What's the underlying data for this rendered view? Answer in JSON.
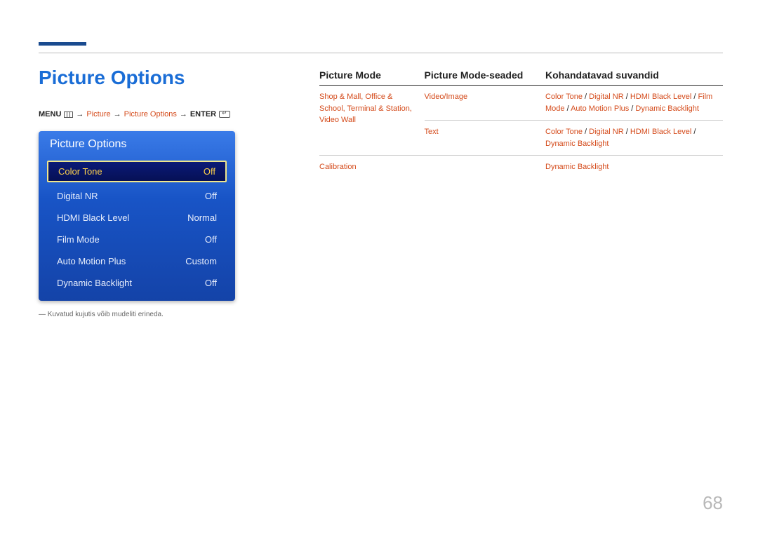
{
  "title": "Picture Options",
  "breadcrumb": {
    "menu": "MENU",
    "seg1": "Picture",
    "seg2": "Picture Options",
    "enter": "ENTER"
  },
  "osd": {
    "title": "Picture Options",
    "rows": [
      {
        "label": "Color Tone",
        "value": "Off"
      },
      {
        "label": "Digital NR",
        "value": "Off"
      },
      {
        "label": "HDMI Black Level",
        "value": "Normal"
      },
      {
        "label": "Film Mode",
        "value": "Off"
      },
      {
        "label": "Auto Motion Plus",
        "value": "Custom"
      },
      {
        "label": "Dynamic Backlight",
        "value": "Off"
      }
    ]
  },
  "footnote": "Kuvatud kujutis võib mudeliti erineda.",
  "table": {
    "headers": {
      "c0": "Picture Mode",
      "c1": "Picture Mode-seaded",
      "c2": "Kohandatavad suvandid"
    },
    "rows": [
      {
        "c0": "Shop & Mall, Office & School, Terminal & Station, Video Wall",
        "c1": "Video/Image",
        "c2_parts": [
          "Color Tone",
          " / ",
          "Digital NR",
          " / ",
          "HDMI Black Level",
          " / ",
          "Film Mode",
          " / ",
          "Auto Motion Plus",
          " / ",
          "Dynamic Backlight"
        ]
      },
      {
        "c0": "",
        "c1": "Text",
        "c2_parts": [
          "Color Tone",
          " / ",
          "Digital NR",
          " / ",
          "HDMI Black Level",
          " / ",
          "Dynamic Backlight"
        ]
      },
      {
        "c0": "Calibration",
        "c1": "",
        "c2_parts": [
          "Dynamic Backlight"
        ]
      }
    ]
  },
  "page_number": "68"
}
